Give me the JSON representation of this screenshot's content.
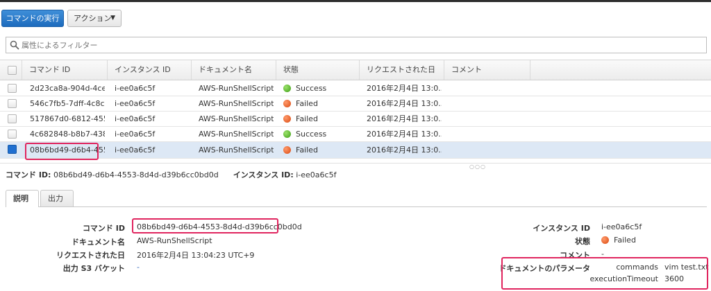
{
  "toolbar": {
    "run_label": "コマンドの実行",
    "action_label": "アクション"
  },
  "search": {
    "placeholder": "属性によるフィルター"
  },
  "table": {
    "headers": [
      "コマンド ID",
      "インスタンス ID",
      "ドキュメント名",
      "状態",
      "リクエストされた日",
      "コメント"
    ],
    "rows": [
      {
        "command_id": "2d23ca8a-904d-4ce...",
        "instance_id": "i-ee0a6c5f",
        "doc": "AWS-RunShellScript",
        "status": "Success",
        "status_type": "success",
        "date": "2016年2月4日 13:0...",
        "comment": "",
        "selected": false
      },
      {
        "command_id": "546c7fb5-7dff-4c8c-...",
        "instance_id": "i-ee0a6c5f",
        "doc": "AWS-RunShellScript",
        "status": "Failed",
        "status_type": "failed",
        "date": "2016年2月4日 13:0...",
        "comment": "",
        "selected": false
      },
      {
        "command_id": "517867d0-6812-455...",
        "instance_id": "i-ee0a6c5f",
        "doc": "AWS-RunShellScript",
        "status": "Failed",
        "status_type": "failed",
        "date": "2016年2月4日 13:0...",
        "comment": "",
        "selected": false
      },
      {
        "command_id": "4c682848-b8b7-438...",
        "instance_id": "i-ee0a6c5f",
        "doc": "AWS-RunShellScript",
        "status": "Success",
        "status_type": "success",
        "date": "2016年2月4日 13:0...",
        "comment": "",
        "selected": false
      },
      {
        "command_id": "08b6bd49-d6b4-455...",
        "instance_id": "i-ee0a6c5f",
        "doc": "AWS-RunShellScript",
        "status": "Failed",
        "status_type": "failed",
        "date": "2016年2月4日 13:0...",
        "comment": "",
        "selected": true
      }
    ]
  },
  "summary": {
    "command_label": "コマンド ID:",
    "command_value": "08b6bd49-d6b4-4553-8d4d-d39b6cc0bd0d",
    "instance_label": "インスタンス ID:",
    "instance_value": "i-ee0a6c5f"
  },
  "tabs": [
    "説明",
    "出力"
  ],
  "details": {
    "left": [
      {
        "label": "コマンド ID",
        "value": "08b6bd49-d6b4-4553-8d4d-d39b6cc0bd0d"
      },
      {
        "label": "ドキュメント名",
        "value": "AWS-RunShellScript"
      },
      {
        "label": "リクエストされた日",
        "value": "2016年2月4日 13:04:23 UTC+9"
      },
      {
        "label": "出力 S3 バケット",
        "value": "-"
      }
    ],
    "right": [
      {
        "label": "インスタンス ID",
        "value": "i-ee0a6c5f"
      },
      {
        "label": "状態",
        "value": "Failed"
      },
      {
        "label": "コメント",
        "value": "-"
      },
      {
        "label": "ドキュメントのパラメータ",
        "value": ""
      }
    ],
    "params": [
      {
        "key": "commands",
        "value": "vim test.txt"
      },
      {
        "key": "executionTimeout",
        "value": "3600"
      }
    ]
  },
  "colors": {
    "primary": "#1d6bbd",
    "success": "#3f9d16",
    "failed": "#d9480f",
    "highlight": "#e0245e",
    "selected_row": "#dde8f5"
  }
}
